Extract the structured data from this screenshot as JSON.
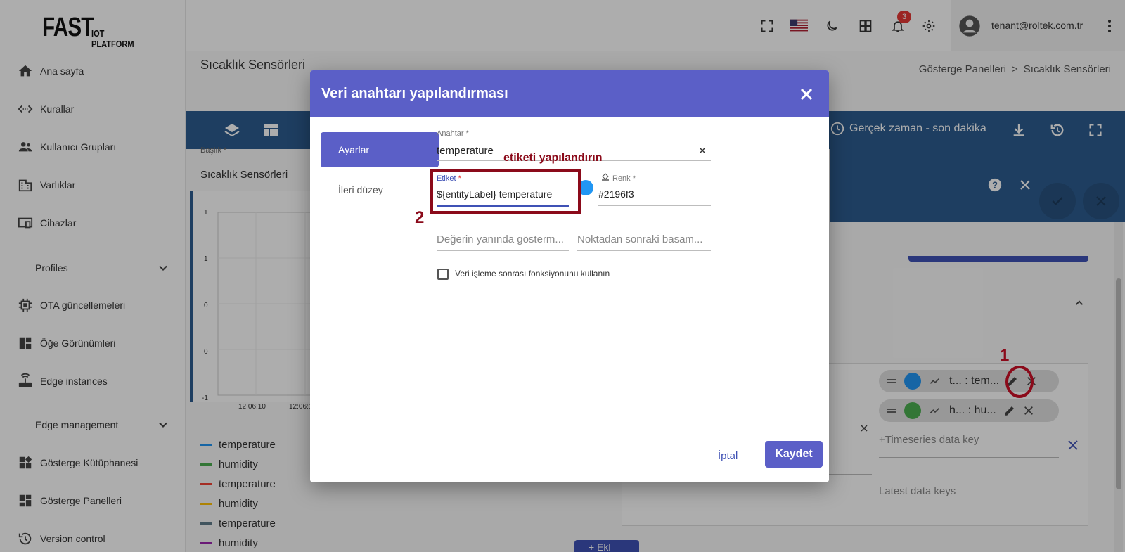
{
  "logo": {
    "big": "FAST",
    "small": "IOT PLATFORM"
  },
  "sidebar": {
    "items": [
      {
        "label": "Ana sayfa"
      },
      {
        "label": "Kurallar"
      },
      {
        "label": "Kullanıcı Grupları"
      },
      {
        "label": "Varlıklar"
      },
      {
        "label": "Cihazlar"
      },
      {
        "label": "Profiles"
      },
      {
        "label": "OTA güncellemeleri"
      },
      {
        "label": "Öğe Görünümleri"
      },
      {
        "label": "Edge instances"
      },
      {
        "label": "Edge management"
      },
      {
        "label": "Gösterge Kütüphanesi"
      },
      {
        "label": "Gösterge Panelleri"
      },
      {
        "label": "Version control"
      }
    ]
  },
  "topbar": {
    "notification_count": "3",
    "user_email": "tenant@roltek.com.tr"
  },
  "page": {
    "title": "Sıcaklık Sensörleri",
    "breadcrumb": [
      "Gösterge Panelleri",
      ">",
      "Sıcaklık Sensörleri"
    ]
  },
  "toolbar": {
    "realtime_label": "Gerçek zaman - son dakika"
  },
  "widget": {
    "title_label": "Başlık *",
    "title_value": "Sıcaklık Sensörleri",
    "y_ticks": [
      "1",
      "1",
      "0",
      "0",
      "-1"
    ],
    "x_ticks": [
      "12:06:10",
      "12:06:1"
    ],
    "legend": [
      {
        "label": "temperature",
        "color": "#2196f3"
      },
      {
        "label": "humidity",
        "color": "#4caf50"
      },
      {
        "label": "temperature",
        "color": "#f44336"
      },
      {
        "label": "humidity",
        "color": "#ffc107"
      },
      {
        "label": "temperature",
        "color": "#607d8b"
      },
      {
        "label": "humidity",
        "color": "#9c27b0"
      }
    ],
    "chips": [
      {
        "text": "t... : tem...",
        "color": "#2196f3"
      },
      {
        "text": "h... : hu...",
        "color": "#4caf50"
      }
    ],
    "timeseries_placeholder": "+Timeseries data key",
    "latest_placeholder": "Latest data keys",
    "bottom_btn": "+ Ekl"
  },
  "dialog": {
    "title": "Veri anahtarı yapılandırması",
    "tabs": [
      "Ayarlar",
      "İleri düzey"
    ],
    "key_label": "Anahtar *",
    "key_value": "temperature",
    "label_label": "Etiket",
    "label_required": "*",
    "label_value": "${entityLabel} temperature",
    "color_label": "Renk *",
    "color_value": "#2196f3",
    "units_placeholder": "Değerin yanında gösterm...",
    "decimals_placeholder": "Noktadan sonraki basam...",
    "postprocess_label": "Veri işleme sonrası fonksiyonunu kullanın",
    "cancel": "İptal",
    "save": "Kaydet"
  },
  "annotations": {
    "hint": "etiketi yapılandırın",
    "step1": "1",
    "step2": "2"
  },
  "colors": {
    "accent": "#5b5fc7",
    "toolbar": "#2d5c8f",
    "annotation": "#8b0a1a"
  }
}
